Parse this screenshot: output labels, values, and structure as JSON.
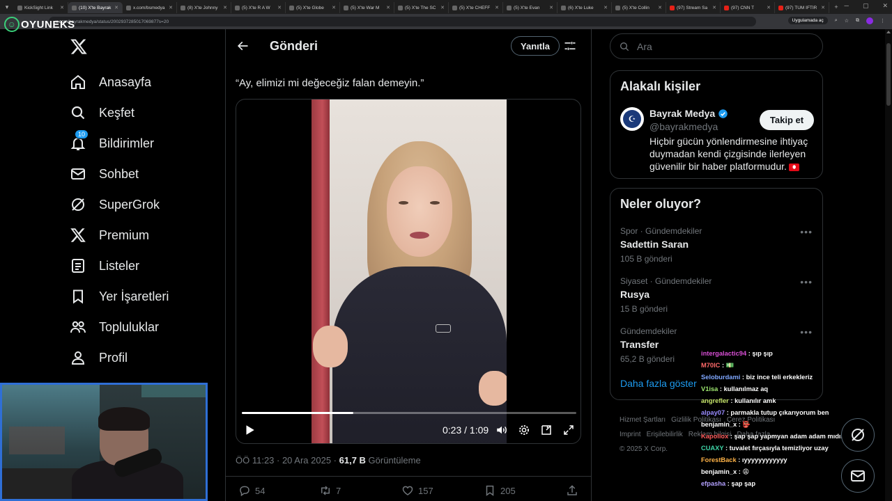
{
  "browser": {
    "tabs": [
      {
        "title": "KickSight Link",
        "active": false,
        "yt": false
      },
      {
        "title": "(10) X'te Bayrak",
        "active": true,
        "yt": false
      },
      {
        "title": "x.com/bsmedya",
        "active": false,
        "yt": false
      },
      {
        "title": "(8) X'te Johnny",
        "active": false,
        "yt": false
      },
      {
        "title": "(5) X'te R A W",
        "active": false,
        "yt": false
      },
      {
        "title": "(5) X'te Globe",
        "active": false,
        "yt": false
      },
      {
        "title": "(5) X'te War M",
        "active": false,
        "yt": false
      },
      {
        "title": "(5) X'te The SC",
        "active": false,
        "yt": false
      },
      {
        "title": "(5) X'te CHEFF",
        "active": false,
        "yt": false
      },
      {
        "title": "(5) X'te Evan",
        "active": false,
        "yt": false
      },
      {
        "title": "(6) X'te Luke",
        "active": false,
        "yt": false
      },
      {
        "title": "(5) X'te Collin",
        "active": false,
        "yt": false
      },
      {
        "title": "(97) Stream Sa",
        "active": false,
        "yt": true
      },
      {
        "title": "(97) CNN T",
        "active": false,
        "yt": true
      },
      {
        "title": "(97) TÜM İFTİR",
        "active": false,
        "yt": true
      }
    ],
    "url_domain": "x.com",
    "url_path": "/bayrakmedya/status/2002937285017069877s=20",
    "app_pill": "Uygulamada aç"
  },
  "stream": {
    "logo_text": "OYUNEKS"
  },
  "nav": {
    "items": [
      {
        "key": "home",
        "label": "Anasayfa"
      },
      {
        "key": "explore",
        "label": "Keşfet"
      },
      {
        "key": "notifications",
        "label": "Bildirimler",
        "badge": "10"
      },
      {
        "key": "chat",
        "label": "Sohbet"
      },
      {
        "key": "supergrok",
        "label": "SuperGrok"
      },
      {
        "key": "premium",
        "label": "Premium"
      },
      {
        "key": "lists",
        "label": "Listeler"
      },
      {
        "key": "bookmarks",
        "label": "Yer İşaretleri"
      },
      {
        "key": "communities",
        "label": "Topluluklar"
      },
      {
        "key": "profile",
        "label": "Profil"
      }
    ]
  },
  "post": {
    "header_title": "Gönderi",
    "reply_label": "Yanıtla",
    "text": "“Ay, elimizi mi değeceğiz falan demeyin.”",
    "video": {
      "time": "0:23 / 1:09",
      "progress": 0.333
    },
    "meta": {
      "time": "ÖÖ 11:23 · 20 Ara 2025 · ",
      "views": "61,7 B",
      "views_label": " Görüntüleme"
    },
    "actions": {
      "replies": "54",
      "reposts": "7",
      "likes": "157",
      "bookmarks": "205"
    }
  },
  "sidebar": {
    "search_placeholder": "Ara",
    "related": {
      "title": "Alakalı kişiler",
      "name": "Bayrak Medya",
      "handle": "@bayrakmedya",
      "follow_label": "Takip et",
      "bio": "Hiçbir gücün yönlendirmesine ihtiyaç duymadan kendi çizgisinde ilerleyen güvenilir bir haber platformudur."
    },
    "trends_title": "Neler oluyor?",
    "trends": [
      {
        "category": "Spor · Gündemdekiler",
        "name": "Sadettin Saran",
        "count": "105 B gönderi"
      },
      {
        "category": "Siyaset · Gündemdekiler",
        "name": "Rusya",
        "count": "15 B gönderi"
      },
      {
        "category": "Gündemdekiler",
        "name": "Transfer",
        "count": "65,2 B gönderi"
      }
    ],
    "show_more": "Daha fazla göster",
    "footer_links": [
      "Hizmet Şartları",
      "Gizlilik Politikası",
      "Çerez Politikası",
      "Imprint",
      "Erişilebilirlik",
      "Reklam bilgisi",
      "Daha fazla ..."
    ],
    "copyright": "© 2025 X Corp."
  },
  "chat": [
    {
      "user": "intergalactic94",
      "color": "#d94fd6",
      "msg": "şıp şıp"
    },
    {
      "user": "M70IC",
      "color": "#ff6a6a",
      "msg": "💵"
    },
    {
      "user": "Seloburdami",
      "color": "#7fa7ff",
      "msg": "biz ince teli erkekleriz"
    },
    {
      "user": "V1isa",
      "color": "#9fe870",
      "msg": "kullanılmaz aq"
    },
    {
      "user": "angrefler",
      "color": "#c7e66b",
      "msg": "kullanılır amk"
    },
    {
      "user": "alpay07",
      "color": "#9a8cff",
      "msg": "parmakla tutup çıkarıyorum ben"
    },
    {
      "user": "benjamin_x",
      "color": "#ffffff",
      "msg": "👺"
    },
    {
      "user": "Kapollox",
      "color": "#ff5b5b",
      "msg": "şap şap yapmyan adam adam mıdır"
    },
    {
      "user": "CUAXY",
      "color": "#3fd6a8",
      "msg": "tuvalet fırçasıyla temizliyor uzay"
    },
    {
      "user": "ForestBack",
      "color": "#ffb347",
      "msg": "ıyyyyyyyyyyyy"
    },
    {
      "user": "benjamin_x",
      "color": "#ffffff",
      "msg": "😩"
    },
    {
      "user": "efpasha",
      "color": "#b3a1ff",
      "msg": "şap şap"
    }
  ],
  "colors": {
    "accent": "#1d9bf0",
    "border": "#2f3336",
    "muted": "#71767b",
    "webcam_border": "#2f6fd6"
  }
}
